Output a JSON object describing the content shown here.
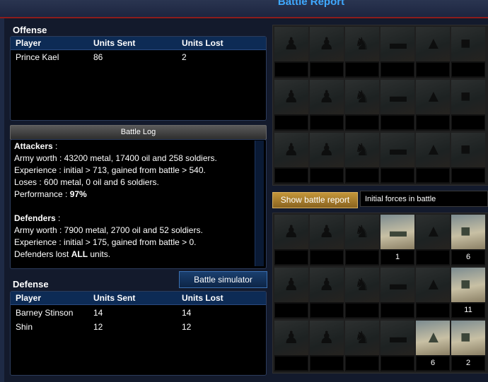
{
  "window": {
    "title": "Battle Report"
  },
  "offense": {
    "label": "Offense",
    "headers": {
      "player": "Player",
      "sent": "Units Sent",
      "lost": "Units Lost"
    },
    "rows": [
      {
        "player": "Prince Kael",
        "sent": "86",
        "lost": "2"
      }
    ]
  },
  "battle_log": {
    "title": "Battle Log",
    "attackers_heading": "Attackers",
    "attackers_lines": [
      "Army worth : 43200 metal, 17400 oil and 258 soldiers.",
      "Experience : initial > 713, gained from battle > 540.",
      "Loses : 600 metal, 0 oil and 6 soldiers."
    ],
    "performance_label": "Performance : ",
    "performance_value": "97%",
    "defenders_heading": "Defenders",
    "defenders_lines": [
      "Army worth : 7900 metal, 2700 oil and 52 soldiers.",
      "Experience : initial > 175, gained from battle > 0."
    ],
    "defenders_lost_prefix": "Defenders lost ",
    "defenders_lost_bold": "ALL",
    "defenders_lost_suffix": " units."
  },
  "defense": {
    "label": "Defense",
    "simulator_button": "Battle simulator",
    "headers": {
      "player": "Player",
      "sent": "Units Sent",
      "lost": "Units Lost"
    },
    "rows": [
      {
        "player": "Barney Stinson",
        "sent": "14",
        "lost": "14"
      },
      {
        "player": "Shin",
        "sent": "12",
        "lost": "12"
      }
    ]
  },
  "show_report_button": "Show battle report",
  "forces_select": "Initial forces in battle",
  "unit_icons": [
    "rifleman-icon",
    "soldier-icon",
    "bazooka-icon",
    "tank-icon",
    "artillery-icon",
    "truck-icon"
  ],
  "top_grid_counts": [
    [
      "",
      "",
      "",
      "",
      "",
      ""
    ],
    [
      "",
      "",
      "",
      "",
      "",
      ""
    ],
    [
      "",
      "",
      "",
      "",
      "",
      ""
    ]
  ],
  "bottom_grid_counts": [
    [
      "",
      "",
      "",
      "1",
      "",
      "6"
    ],
    [
      "",
      "",
      "",
      "",
      "",
      "11"
    ],
    [
      "",
      "",
      "",
      "",
      "6",
      "2"
    ]
  ]
}
